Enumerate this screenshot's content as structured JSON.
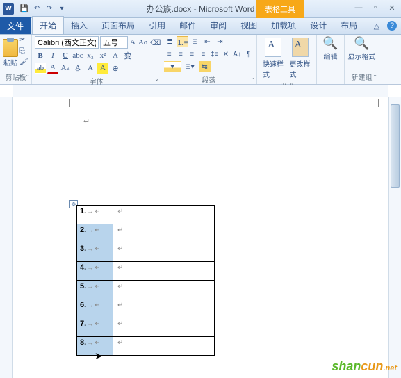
{
  "title": "办公族.docx - Microsoft Word",
  "table_tools": "表格工具",
  "tabs": {
    "file": "文件",
    "home": "开始",
    "insert": "插入",
    "layout": "页面布局",
    "ref": "引用",
    "mail": "邮件",
    "review": "审阅",
    "view": "视图",
    "addin": "加载项",
    "design": "设计",
    "tlayout": "布局"
  },
  "groups": {
    "clipboard": "剪贴板",
    "font": "字体",
    "paragraph": "段落",
    "styles": "样式",
    "newgroup": "新建组"
  },
  "clipboard": {
    "paste": "粘贴"
  },
  "font": {
    "name": "Calibri (西文正文)",
    "size": "五号"
  },
  "styles": {
    "quick": "快速样式",
    "change": "更改样式"
  },
  "edit": {
    "label": "编辑"
  },
  "newgroup": {
    "label": "显示格式"
  },
  "table": {
    "rows": [
      {
        "num": "1."
      },
      {
        "num": "2."
      },
      {
        "num": "3."
      },
      {
        "num": "4."
      },
      {
        "num": "5."
      },
      {
        "num": "6."
      },
      {
        "num": "7."
      },
      {
        "num": "8."
      }
    ]
  },
  "watermark": {
    "text1": "shan",
    "text2": "cun",
    "net": ".net"
  }
}
